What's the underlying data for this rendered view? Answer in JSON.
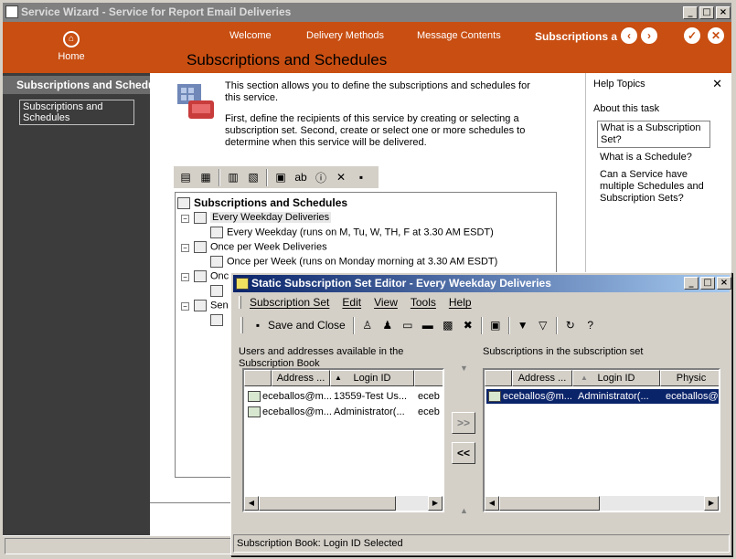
{
  "wizard": {
    "title": "Service Wizard - Service for Report Email Deliveries",
    "nav": {
      "home": "Home",
      "tabs": [
        "Welcome",
        "Delivery Methods",
        "Message Contents",
        "Subscriptions a"
      ]
    },
    "sidebar": {
      "heading": "Subscriptions and Schedu",
      "item": "Subscriptions and Schedules"
    },
    "page_title": "Subscriptions and Schedules",
    "intro": {
      "p1": "This section allows you to define the subscriptions and schedules for this service.",
      "p2": "First, define the recipients of this service by creating or selecting a subscription set. Second, create or select one or more schedules to determine when this service will be delivered."
    },
    "tree": {
      "root": "Subscriptions and Schedules",
      "nodes": [
        {
          "label": "Every Weekday Deliveries",
          "child": "Every Weekday (runs on M, Tu, W, TH, F at 3.30 AM ESDT)"
        },
        {
          "label": "Once per Week Deliveries",
          "child": "Once per Week (runs on Monday morning at 3.30 AM ESDT)"
        },
        {
          "label": "Onc"
        },
        {
          "label": "Sen"
        }
      ]
    },
    "help": {
      "title": "Help Topics",
      "close": "✕",
      "section": "About this task",
      "links": [
        "What is a Subscription Set?",
        "What is a Schedule?",
        "Can a Service have multiple Schedules and Subscription Sets?"
      ]
    }
  },
  "dialog": {
    "title": "Static Subscription Set Editor - Every Weekday Deliveries",
    "menu": [
      "Subscription Set",
      "Edit",
      "View",
      "Tools",
      "Help"
    ],
    "save_close": "Save and Close",
    "left_label": "Users and addresses available in the Subscription Book",
    "right_label": "Subscriptions in the subscription set",
    "left_columns": [
      "Address ...",
      "Login ID",
      ""
    ],
    "right_columns": [
      "Address ...",
      "Login ID",
      "Physic"
    ],
    "left_rows": [
      [
        "eceballos@m...",
        "13559-Test Us...",
        "eceb"
      ],
      [
        "eceballos@m...",
        "Administrator(...",
        "eceb"
      ]
    ],
    "right_rows": [
      [
        "eceballos@m...",
        "Administrator(...",
        "eceballos@m"
      ]
    ],
    "add_button": ">>",
    "remove_button": "<<",
    "status": "Subscription Book: Login ID Selected"
  },
  "colors": {
    "brand_orange": "#c84e12",
    "selection_blue": "#0a246a",
    "sidebar_dark": "#3c3c3c"
  }
}
